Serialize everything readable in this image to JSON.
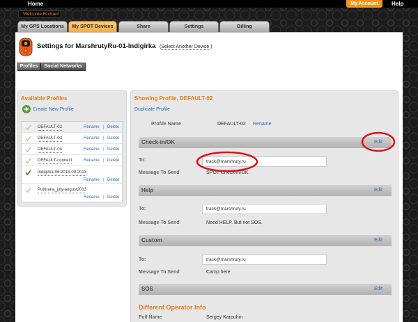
{
  "topbar": {
    "home": "Home",
    "my_account": "My Account",
    "help": "Help"
  },
  "welcome": "Welcome Roman!",
  "tabs": [
    {
      "label": "My GPS Locations",
      "active": false
    },
    {
      "label": "My SPOT Devices",
      "active": true
    },
    {
      "label": "Share",
      "active": false
    },
    {
      "label": "Settings",
      "active": false
    },
    {
      "label": "Billing",
      "active": false
    }
  ],
  "header": {
    "device_icon": "spot-device-icon",
    "title": "Settings for MarshrutyRu-01-Indigirka",
    "select_prefix": "(",
    "select_link": "Select Another Device",
    "select_suffix": " )"
  },
  "subnav": [
    {
      "label": "Profiles",
      "active": true
    },
    {
      "label": "Social Networks",
      "active": false
    }
  ],
  "available_profiles": {
    "title": "Available Profiles",
    "create_icon": "add-circle-icon",
    "create_label": "Create New Profile",
    "check_icon": "checkmark-icon",
    "rename_label": "Rename",
    "separator": "|",
    "delete_label": "Delete",
    "items": [
      {
        "name": "DEFAULT-02",
        "selected": true,
        "active": false
      },
      {
        "name": "DEFAULT-03",
        "selected": false,
        "active": false
      },
      {
        "name": "DEFAULT-04",
        "selected": false,
        "active": false
      },
      {
        "name": "DEFAULT-connect",
        "selected": false,
        "active": false
      },
      {
        "name": "Indigirka-06.2013-09.2013",
        "selected": false,
        "active": true
      },
      {
        "name": "Putorana_july-august2013",
        "selected": false,
        "active": false
      }
    ]
  },
  "profile": {
    "title": "Showing Profile, DEFAULT-02",
    "duplicate_label": "Duplicate Profile",
    "name_label": "Profile Name",
    "name_value": "DEFAULT-02",
    "rename_label": "Rename",
    "edit_label": "Edit",
    "to_label": "To:",
    "message_label": "Message To Send",
    "sections": [
      {
        "title": "Check-in/OK",
        "to": "track@marshruty.ru",
        "message": "SPOT Check-in/OK."
      },
      {
        "title": "Help",
        "to": "track@marshruty.ru",
        "message": "Need HELP. But not SOS."
      },
      {
        "title": "Custom",
        "to": "track@marshruty.ru",
        "message": "Camp here"
      },
      {
        "title": "SOS"
      }
    ],
    "operator": {
      "title": "Different Operator Info",
      "full_name_label": "Full Name",
      "full_name": "Sergey Karpuhin"
    }
  },
  "colors": {
    "accent_orange": "#df7d1c",
    "link_blue": "#2c6db3",
    "account_button": "#f39421",
    "active_tab": "#f0ab45",
    "check_active": "#3f9b2e",
    "check_inactive": "#b2d6a3",
    "annotation_red": "#d7141b"
  }
}
